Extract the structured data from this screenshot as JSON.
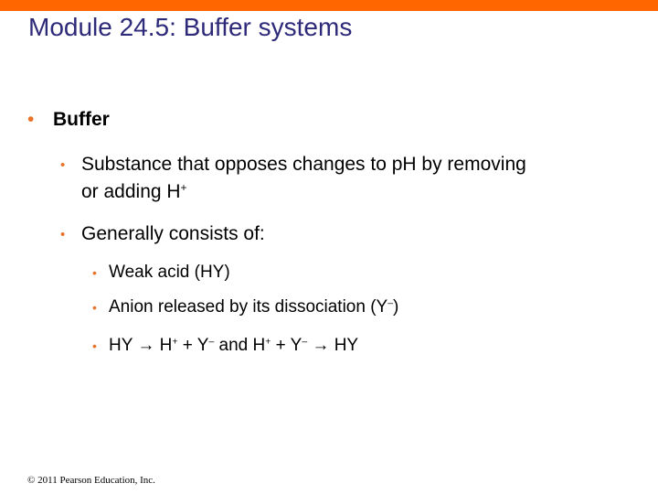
{
  "accent_color": "#ff6600",
  "title": "Module 24.5: Buffer systems",
  "bullets": {
    "level1": "Buffer",
    "definition_line1": "Substance that opposes changes to pH by removing",
    "definition_line2": "or adding H",
    "definition_sup": "+",
    "consists": "Generally consists of:",
    "weak_acid": "Weak acid (HY)",
    "anion_text": "Anion released by its dissociation (Y",
    "anion_sup": "–",
    "anion_close": ")",
    "eq": {
      "a": "HY ",
      "arrow": "→",
      "b": " H",
      "plus_sup": "+",
      "c": " + Y",
      "minus_sup": "–",
      "d": "   and  H",
      "e": " + Y",
      "f": " HY"
    }
  },
  "bullet_glyph": "•",
  "footer": "© 2011 Pearson Education, Inc."
}
